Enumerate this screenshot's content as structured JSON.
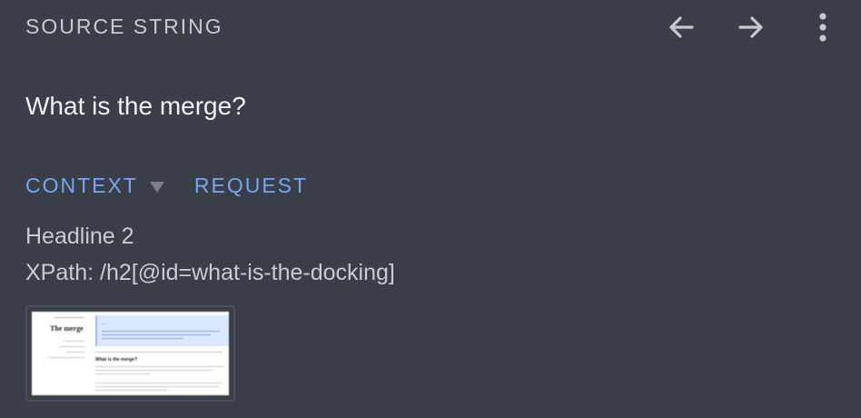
{
  "header": {
    "title": "SOURCE STRING",
    "icons": [
      "arrow-left-icon",
      "arrow-right-icon",
      "more-vert-icon"
    ]
  },
  "source": {
    "text": "What is the merge?"
  },
  "tabs": [
    {
      "label": "CONTEXT",
      "dropdown": true
    },
    {
      "label": "REQUEST"
    }
  ],
  "context": {
    "element_type": "Headline 2",
    "xpath": "XPath: /h2[@id=what-is-the-docking]"
  },
  "screenshot_preview": {
    "page_title": "The merge",
    "section_title": "What is the merge?",
    "banner_title": "...",
    "colors": {
      "banner": "#dbe7ff",
      "link": "#3b63d9"
    }
  },
  "colors": {
    "background": "#3a3e48",
    "accent": "#76a6f2",
    "muted": "#c8cbd1"
  }
}
